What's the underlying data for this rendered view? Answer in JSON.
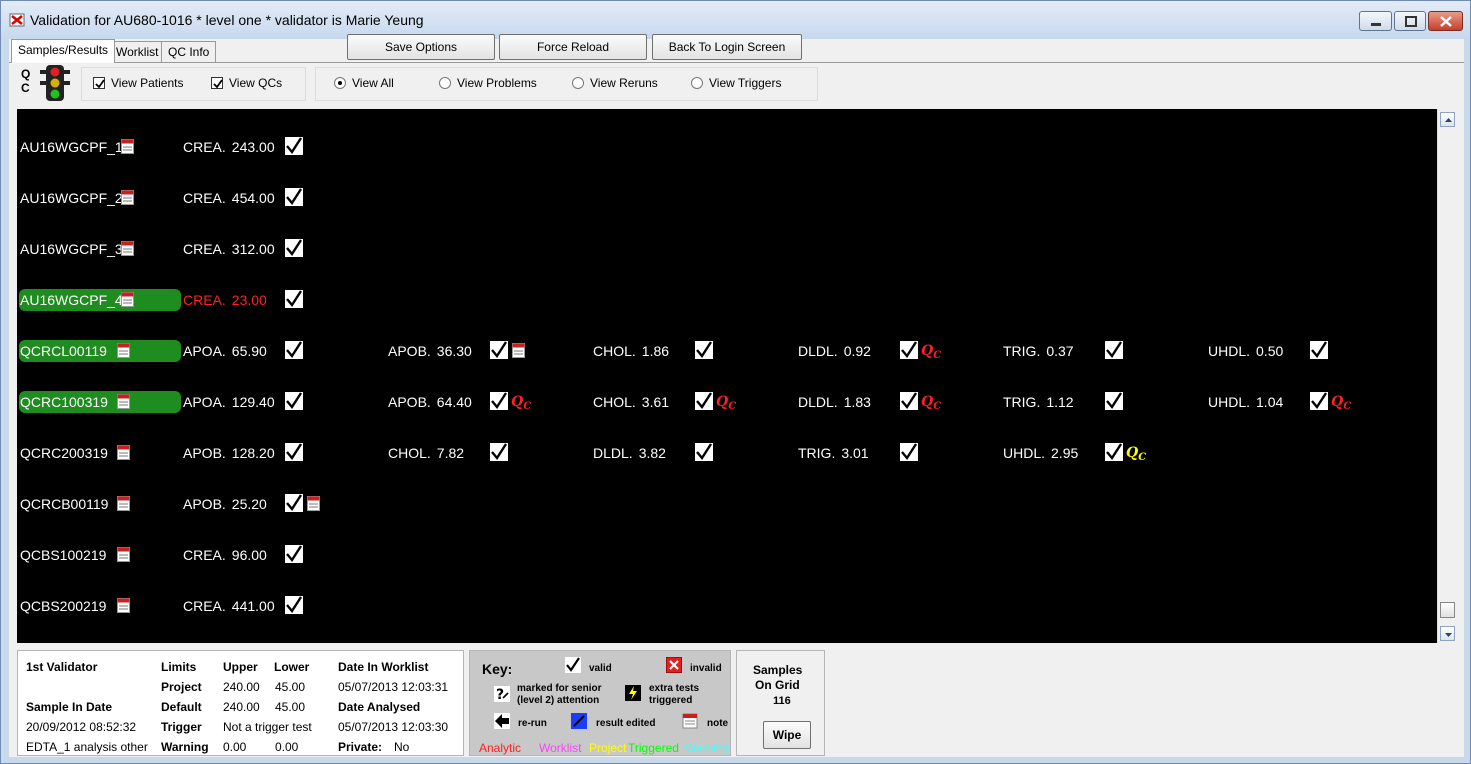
{
  "window": {
    "title": "Validation for AU680-1016 * level one * validator is Marie Yeung"
  },
  "tabs": [
    {
      "label": "Samples/Results"
    },
    {
      "label": "Worklist"
    },
    {
      "label": "QC Info"
    }
  ],
  "toolbar": {
    "save_options": "Save Options",
    "force_reload": "Force Reload",
    "back_to_login": "Back To Login Screen"
  },
  "qc_indicator": {
    "label": "Q C"
  },
  "filters": {
    "view_patients": {
      "label": "View Patients",
      "checked": true
    },
    "view_qcs": {
      "label": "View QCs",
      "checked": true
    },
    "radios": [
      {
        "label": "View All",
        "selected": true
      },
      {
        "label": "View Problems",
        "selected": false
      },
      {
        "label": "View Reruns",
        "selected": false
      },
      {
        "label": "View Triggers",
        "selected": false
      }
    ]
  },
  "rows": [
    {
      "id": "AU16WGCPF_1",
      "results": [
        {
          "test": "CREA.",
          "value": "243.00",
          "qc": null
        }
      ]
    },
    {
      "id": "AU16WGCPF_2",
      "results": [
        {
          "test": "CREA.",
          "value": "454.00",
          "qc": null
        }
      ]
    },
    {
      "id": "AU16WGCPF_3",
      "results": [
        {
          "test": "CREA.",
          "value": "312.00",
          "qc": null
        }
      ]
    },
    {
      "id": "AU16WGCPF_4",
      "highlight": true,
      "results": [
        {
          "test": "CREA.",
          "value": "23.00",
          "invalid": true,
          "qc": null
        }
      ]
    },
    {
      "id": "QCRCL00119",
      "highlight": true,
      "results": [
        {
          "test": "APOA.",
          "value": "65.90",
          "qc": null
        },
        {
          "test": "APOB.",
          "value": "36.30",
          "note": true,
          "qc": null
        },
        {
          "test": "CHOL.",
          "value": "1.86",
          "qc": null
        },
        {
          "test": "DLDL.",
          "value": "0.92",
          "qc": "red"
        },
        {
          "test": "TRIG.",
          "value": "0.37",
          "qc": null
        },
        {
          "test": "UHDL.",
          "value": "0.50",
          "qc": null
        }
      ]
    },
    {
      "id": "QCRC100319",
      "highlight": true,
      "results": [
        {
          "test": "APOA.",
          "value": "129.40",
          "qc": null
        },
        {
          "test": "APOB.",
          "value": "64.40",
          "qc": "red"
        },
        {
          "test": "CHOL.",
          "value": "3.61",
          "qc": "red"
        },
        {
          "test": "DLDL.",
          "value": "1.83",
          "qc": "red"
        },
        {
          "test": "TRIG.",
          "value": "1.12",
          "qc": null
        },
        {
          "test": "UHDL.",
          "value": "1.04",
          "qc": "red"
        }
      ]
    },
    {
      "id": "QCRC200319",
      "results": [
        {
          "test": "APOB.",
          "value": "128.20",
          "qc": null
        },
        {
          "test": "CHOL.",
          "value": "7.82",
          "qc": null
        },
        {
          "test": "DLDL.",
          "value": "3.82",
          "qc": null
        },
        {
          "test": "TRIG.",
          "value": "3.01",
          "qc": null
        },
        {
          "test": "UHDL.",
          "value": "2.95",
          "qc": "yellow"
        }
      ]
    },
    {
      "id": "QCRCB00119",
      "results": [
        {
          "test": "APOB.",
          "value": "25.20",
          "note": true,
          "qc": null
        }
      ]
    },
    {
      "id": "QCBS100219",
      "results": [
        {
          "test": "CREA.",
          "value": "96.00",
          "qc": null
        }
      ]
    },
    {
      "id": "QCBS200219",
      "results": [
        {
          "test": "CREA.",
          "value": "441.00",
          "qc": null
        }
      ]
    }
  ],
  "qc_mark": {
    "q": "Q",
    "c": "C"
  },
  "info": {
    "first_validator": "1st  Validator",
    "sample_in_date_label": "Sample In Date",
    "sample_in_date": "20/09/2012 08:52:32",
    "sample_type": "EDTA_1 analysis other",
    "limits_label": "Limits",
    "upper_label": "Upper",
    "lower_label": "Lower",
    "project_label": "Project",
    "project_upper": "240.00",
    "project_lower": "45.00",
    "default_label": "Default",
    "default_upper": "240.00",
    "default_lower": "45.00",
    "trigger_label": "Trigger",
    "trigger_value": "Not a trigger test",
    "warning_label": "Warning",
    "warning_upper": "0.00",
    "warning_lower": "0.00",
    "date_in_worklist_label": "Date In Worklist",
    "date_in_worklist": "05/07/2013 12:03:31",
    "date_analysed_label": "Date Analysed",
    "date_analysed": "05/07/2013 12:03:30",
    "private_label": "Private:",
    "private_value": "No"
  },
  "key": {
    "title": "Key:",
    "valid": "valid",
    "invalid": "invalid",
    "senior_1": "marked for senior",
    "senior_2": "(level 2) attention",
    "extra_1": "extra tests",
    "extra_2": "triggered",
    "rerun": "re-run",
    "edited": "result edited",
    "note": "note",
    "legend": [
      {
        "label": "Analytic",
        "color": "#ff2020"
      },
      {
        "label": "Worklist",
        "color": "#ff40ff"
      },
      {
        "label": "Project",
        "color": "#ffff00"
      },
      {
        "label": "Triggered",
        "color": "#00ff00"
      },
      {
        "label": "Warning",
        "color": "#40ffff"
      }
    ]
  },
  "samples_on_grid": {
    "label_1": "Samples",
    "label_2": "On Grid",
    "count": "116",
    "wipe": "Wipe"
  }
}
